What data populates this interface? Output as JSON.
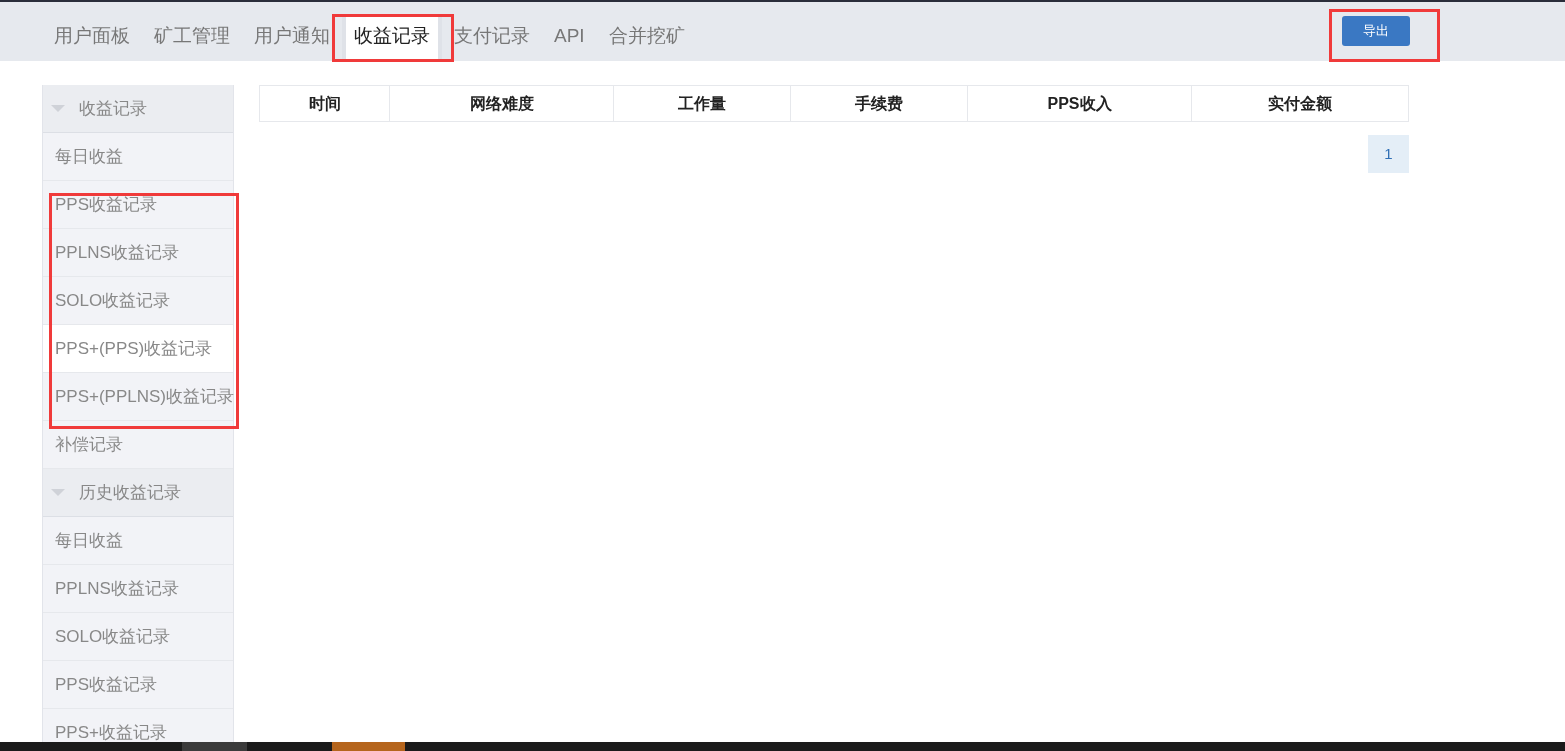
{
  "tabs": [
    {
      "label": "用户面板",
      "selected": false,
      "highlighted": false
    },
    {
      "label": "矿工管理",
      "selected": false,
      "highlighted": false
    },
    {
      "label": "用户通知",
      "selected": false,
      "highlighted": false
    },
    {
      "label": "收益记录",
      "selected": true,
      "highlighted": true
    },
    {
      "label": "支付记录",
      "selected": false,
      "highlighted": false
    },
    {
      "label": "API",
      "selected": false,
      "highlighted": false
    },
    {
      "label": "合并挖矿",
      "selected": false,
      "highlighted": false
    }
  ],
  "export_button": {
    "label": "导出",
    "highlighted": true
  },
  "sidebar": {
    "groups": [
      {
        "title": "收益记录",
        "expanded": true,
        "items": [
          {
            "label": "每日收益",
            "selected": false,
            "highlighted": false
          },
          {
            "label": "PPS收益记录",
            "selected": false,
            "highlighted": true
          },
          {
            "label": "PPLNS收益记录",
            "selected": false,
            "highlighted": true
          },
          {
            "label": "SOLO收益记录",
            "selected": false,
            "highlighted": true
          },
          {
            "label": "PPS+(PPS)收益记录",
            "selected": true,
            "highlighted": true
          },
          {
            "label": "PPS+(PPLNS)收益记录",
            "selected": false,
            "highlighted": true
          },
          {
            "label": "补偿记录",
            "selected": false,
            "highlighted": false
          }
        ]
      },
      {
        "title": "历史收益记录",
        "expanded": true,
        "items": [
          {
            "label": "每日收益",
            "selected": false,
            "highlighted": false
          },
          {
            "label": "PPLNS收益记录",
            "selected": false,
            "highlighted": false
          },
          {
            "label": "SOLO收益记录",
            "selected": false,
            "highlighted": false
          },
          {
            "label": "PPS收益记录",
            "selected": false,
            "highlighted": false
          },
          {
            "label": "PPS+收益记录",
            "selected": false,
            "highlighted": false
          }
        ]
      }
    ]
  },
  "table": {
    "columns": [
      "时间",
      "网络难度",
      "工作量",
      "手续费",
      "PPS收入",
      "实付金额"
    ]
  },
  "pagination": {
    "pages": [
      {
        "label": "1",
        "selected": true
      }
    ]
  }
}
